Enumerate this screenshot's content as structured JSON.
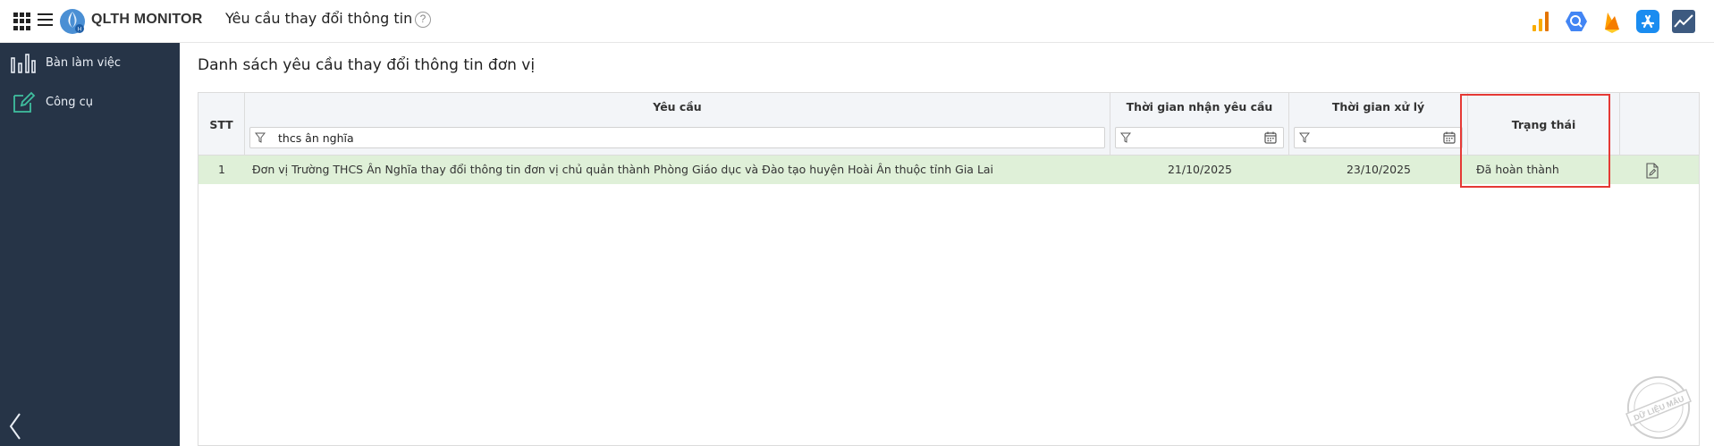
{
  "header": {
    "brand": "QLTH MONITOR",
    "page_title": "Yêu cầu thay đổi thông tin",
    "help_glyph": "?",
    "icons": [
      "apps-grid-icon",
      "hamburger-menu-icon",
      "bar-chart-icon",
      "bigquery-icon",
      "firebase-icon",
      "app-store-icon",
      "analytics-trend-icon"
    ]
  },
  "sidebar": {
    "items": [
      {
        "label": "Bàn làm việc",
        "icon": "dashboard-bars-icon"
      },
      {
        "label": "Công cụ",
        "icon": "edit-icon"
      }
    ],
    "collapse_icon": "chevron-left-icon"
  },
  "main": {
    "title": "Danh sách yêu cầu thay đổi thông tin đơn vị",
    "columns": {
      "stt": "STT",
      "request": "Yêu cầu",
      "received_time": "Thời gian nhận yêu cầu",
      "processed_time": "Thời gian xử lý",
      "status": "Trạng thái"
    },
    "filters": {
      "request_value": "thcs ân nghĩa",
      "received_time_value": "",
      "processed_time_value": ""
    },
    "rows": [
      {
        "stt": "1",
        "request": "Đơn vị Trường THCS Ân Nghĩa thay đổi thông tin đơn vị chủ quản thành Phòng Giáo dục và Đào tạo huyện Hoài Ân thuộc tỉnh Gia Lai",
        "received_time": "21/10/2025",
        "processed_time": "23/10/2025",
        "status": "Đã hoàn thành",
        "action_icon": "edit-document-icon"
      }
    ]
  },
  "colors": {
    "sidebar_bg": "#263447",
    "header_bg": "#f3f5f8",
    "row_highlight": "#dff0d8",
    "annotation_border": "#e53935"
  }
}
